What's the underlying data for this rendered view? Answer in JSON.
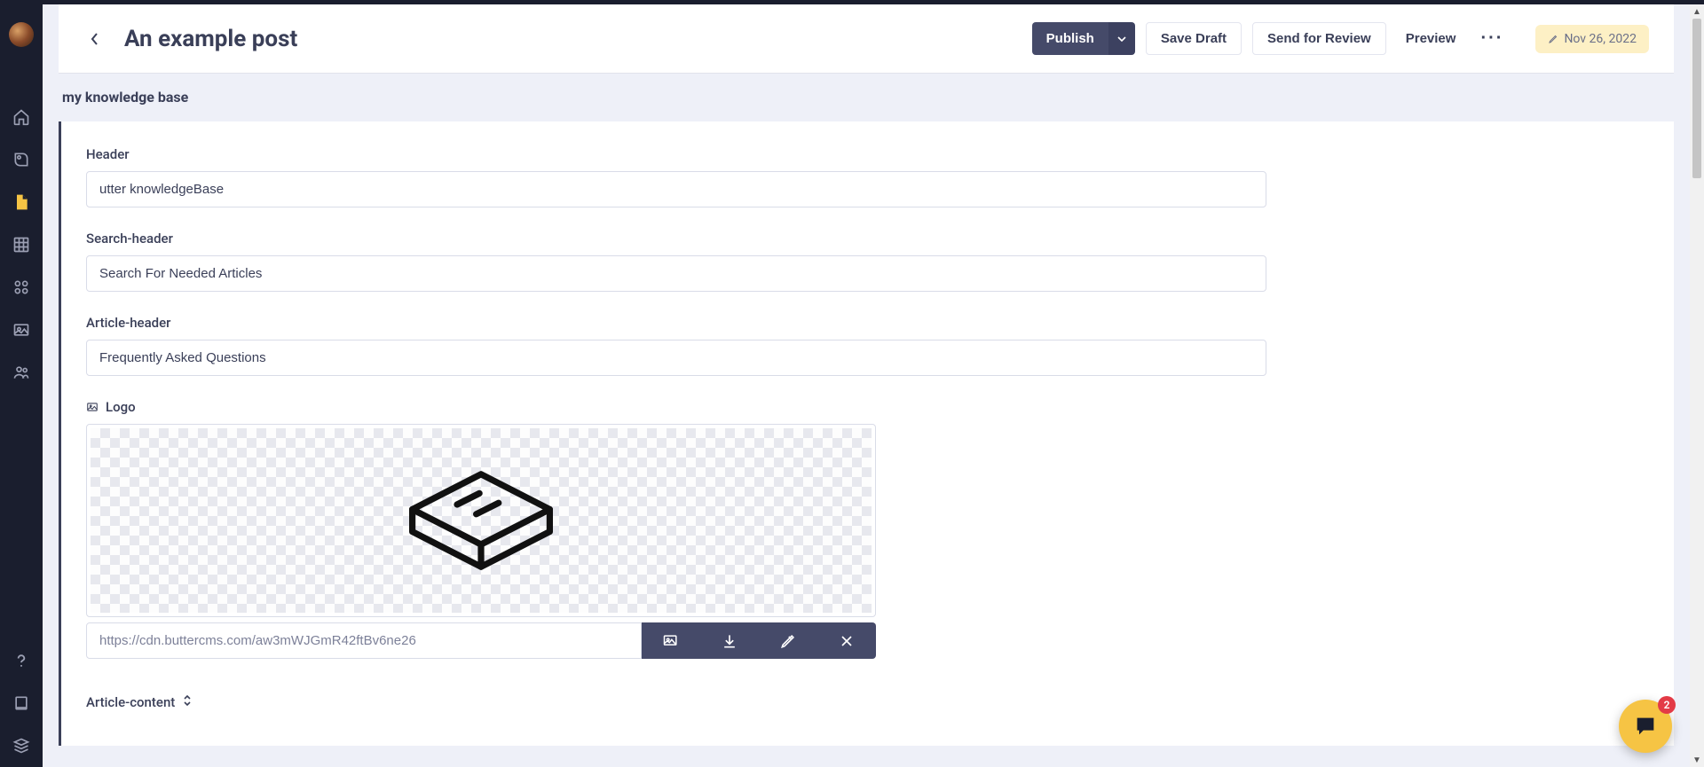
{
  "header": {
    "title": "An example post",
    "actions": {
      "publish": "Publish",
      "save_draft": "Save Draft",
      "send_review": "Send for Review",
      "preview": "Preview"
    },
    "date": "Nov 26, 2022"
  },
  "breadcrumb": "my knowledge base",
  "form": {
    "header": {
      "label": "Header",
      "value": "utter knowledgeBase"
    },
    "search_header": {
      "label": "Search-header",
      "value": "Search For Needed Articles"
    },
    "article_header": {
      "label": "Article-header",
      "value": "Frequently Asked Questions"
    },
    "logo": {
      "label": "Logo",
      "url": "https://cdn.buttercms.com/aw3mWJGmR42ftBv6ne26"
    },
    "article_content": {
      "label": "Article-content"
    }
  },
  "chat": {
    "badge": "2"
  },
  "sidebar_icons": [
    "home",
    "blog",
    "pages",
    "grid",
    "modules",
    "media",
    "users",
    "help",
    "docs",
    "stack"
  ]
}
